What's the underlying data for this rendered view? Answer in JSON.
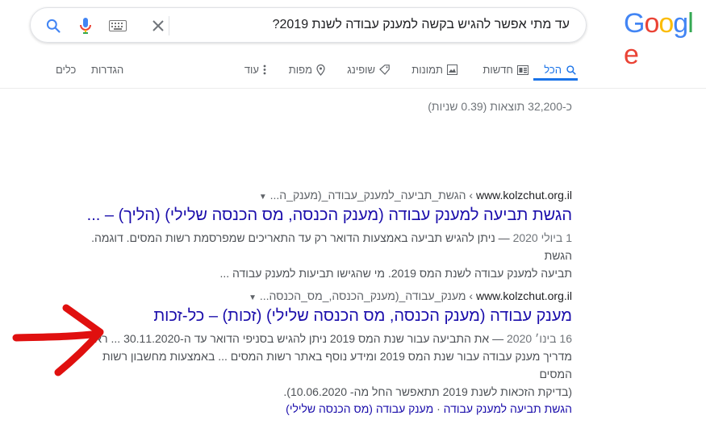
{
  "logo": "Google",
  "search": {
    "query": "עד מתי אפשר להגיש בקשה למענק עבודה לשנת 2019?"
  },
  "tabs": [
    {
      "label": "הכל",
      "icon": "search-icon",
      "active": true
    },
    {
      "label": "חדשות",
      "icon": "news-icon"
    },
    {
      "label": "תמונות",
      "icon": "image-icon"
    },
    {
      "label": "שופינג",
      "icon": "tag-icon"
    },
    {
      "label": "מפות",
      "icon": "map-pin-icon"
    },
    {
      "label": "עוד",
      "icon": "more-vert-icon"
    }
  ],
  "tools": {
    "settings": "הגדרות",
    "tools": "כלים"
  },
  "stats": "כ-32,200 תוצאות (0.39 שניות)",
  "results": [
    {
      "domain": "www.kolzchut.org.il",
      "path": " › הגשת_תביעה_למענק_עבודה_(מענק_ה...",
      "title": "הגשת תביעה למענק עבודה (מענק הכנסה, מס הכנסה שלילי) (הליך) – ...",
      "date": "1 ביולי 2020",
      "snippet_line1": " — ניתן להגיש תביעה באמצעות הדואר רק עד התאריכים שמפרסמת רשות המסים. דוגמה. הגשת",
      "snippet_line2": "תביעה למענק עבודה לשנת המס 2019. מי שהגישו תביעות למענק עבודה ..."
    },
    {
      "domain": "www.kolzchut.org.il",
      "path": " › מענק_עבודה_(מענק_הכנסה,_מס_הכנסה...",
      "title": "מענק עבודה (מענק הכנסה, מס הכנסה שלילי) (זכות) – כל-זכות",
      "date": "16 בינו׳ 2020",
      "snippet_line1": " — את התביעה עבור שנת המס 2019 ניתן להגיש בסניפי הדואר עד ה-30.11.2020 ... ראו",
      "snippet_line2": "מדריך מענק עבודה עבור שנת המס 2019 ומידע נוסף באתר רשות המסים ... באמצעות מחשבון רשות המסים",
      "snippet_line3": "(בדיקת הזכאות לשנת 2019 תתאפשר החל מה- 10.06.2020).",
      "sitelink1": "הגשת תביעה למענק עבודה",
      "sitelink2": "מענק עבודה (מס הכנסה שלילי)"
    }
  ],
  "colors": {
    "link": "#1a0dab",
    "accent": "#1a73e8",
    "arrow": "#e0100f"
  }
}
